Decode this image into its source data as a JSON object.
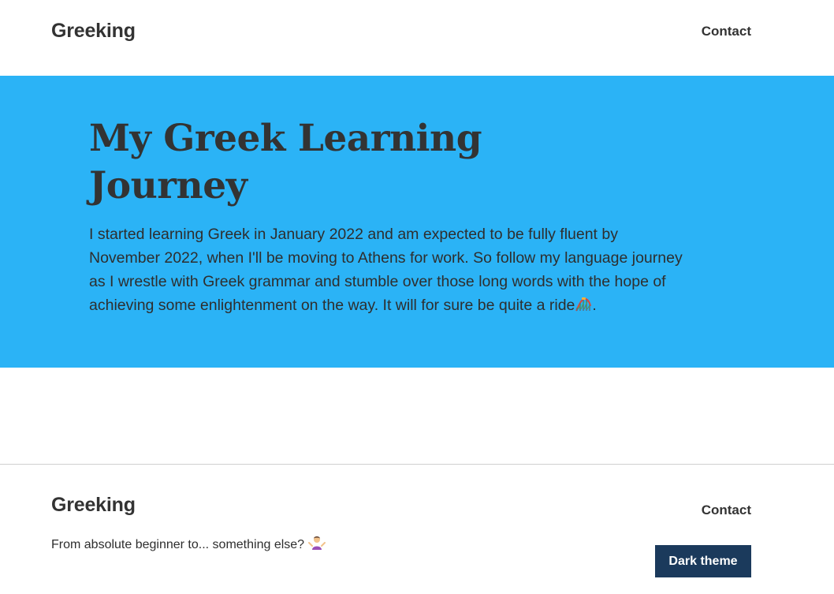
{
  "header": {
    "brand": "Greeking",
    "nav": {
      "contact": "Contact"
    }
  },
  "hero": {
    "title": "My Greek Learning Journey",
    "text": "I started learning Greek in January 2022 and am expected to be fully fluent by November 2022, when I'll be moving to Athens for work. So follow my language journey as I wrestle with Greek grammar and stumble over those long words with the hope of achieving some enlightenment on the way. It will for sure be quite a ride",
    "text_end": ".",
    "emoji_icon": "roller-coaster-icon"
  },
  "footer": {
    "brand": "Greeking",
    "tagline": "From absolute beginner to... something else?",
    "tagline_icon": "person-shrugging-icon",
    "contact": "Contact",
    "theme_button": "Dark theme"
  },
  "colors": {
    "hero_background": "#2bb3f6",
    "button_background": "#1b3a5c",
    "text": "#333333",
    "divider": "#cfcfcf"
  }
}
